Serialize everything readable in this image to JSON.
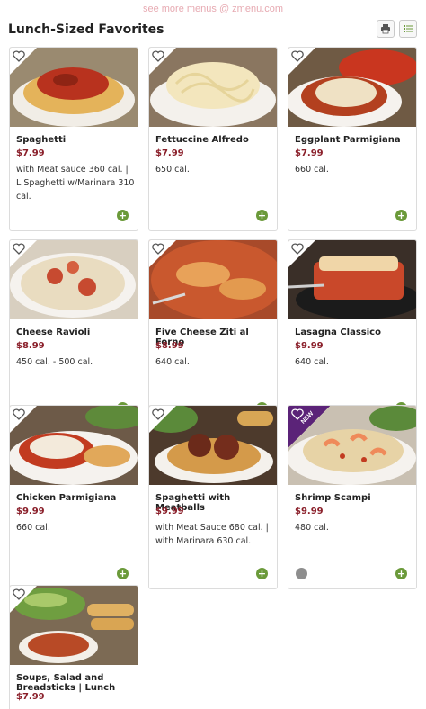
{
  "watermark": "see more menus @ zmenu.com",
  "page": {
    "title": "Lunch-Sized Favorites"
  },
  "toolbar": {
    "print_icon": "printer-icon",
    "list_icon": "list-view-icon"
  },
  "colors": {
    "price": "#8a1f2a",
    "add_button": "#6b9a3a",
    "new_badge": "#5b2378"
  },
  "items": [
    {
      "name": "Spaghetti",
      "price": "$7.99",
      "desc": "with Meat sauce 360 cal. | L Spaghetti w/Marinara 310 cal."
    },
    {
      "name": "Fettuccine Alfredo",
      "price": "$7.99",
      "desc": "650 cal."
    },
    {
      "name": "Eggplant Parmigiana",
      "price": "$7.99",
      "desc": "660 cal."
    },
    {
      "name": "Cheese Ravioli",
      "price": "$8.99",
      "desc": "450 cal. - 500 cal."
    },
    {
      "name": "Five Cheese Ziti al Forno",
      "price": "$8.99",
      "desc": "640 cal."
    },
    {
      "name": "Lasagna Classico",
      "price": "$9.99",
      "desc": "640 cal."
    },
    {
      "name": "Chicken Parmigiana",
      "price": "$9.99",
      "desc": "660 cal."
    },
    {
      "name": "Spaghetti with Meatballs",
      "price": "$9.99",
      "desc": "with Meat Sauce 680 cal. | with Marinara 630 cal."
    },
    {
      "name": "Shrimp Scampi",
      "price": "$9.99",
      "desc": "480 cal.",
      "badge": "NEW"
    },
    {
      "name": "Soups, Salad and Breadsticks | Lunch",
      "price": "$7.99",
      "desc": ""
    }
  ]
}
